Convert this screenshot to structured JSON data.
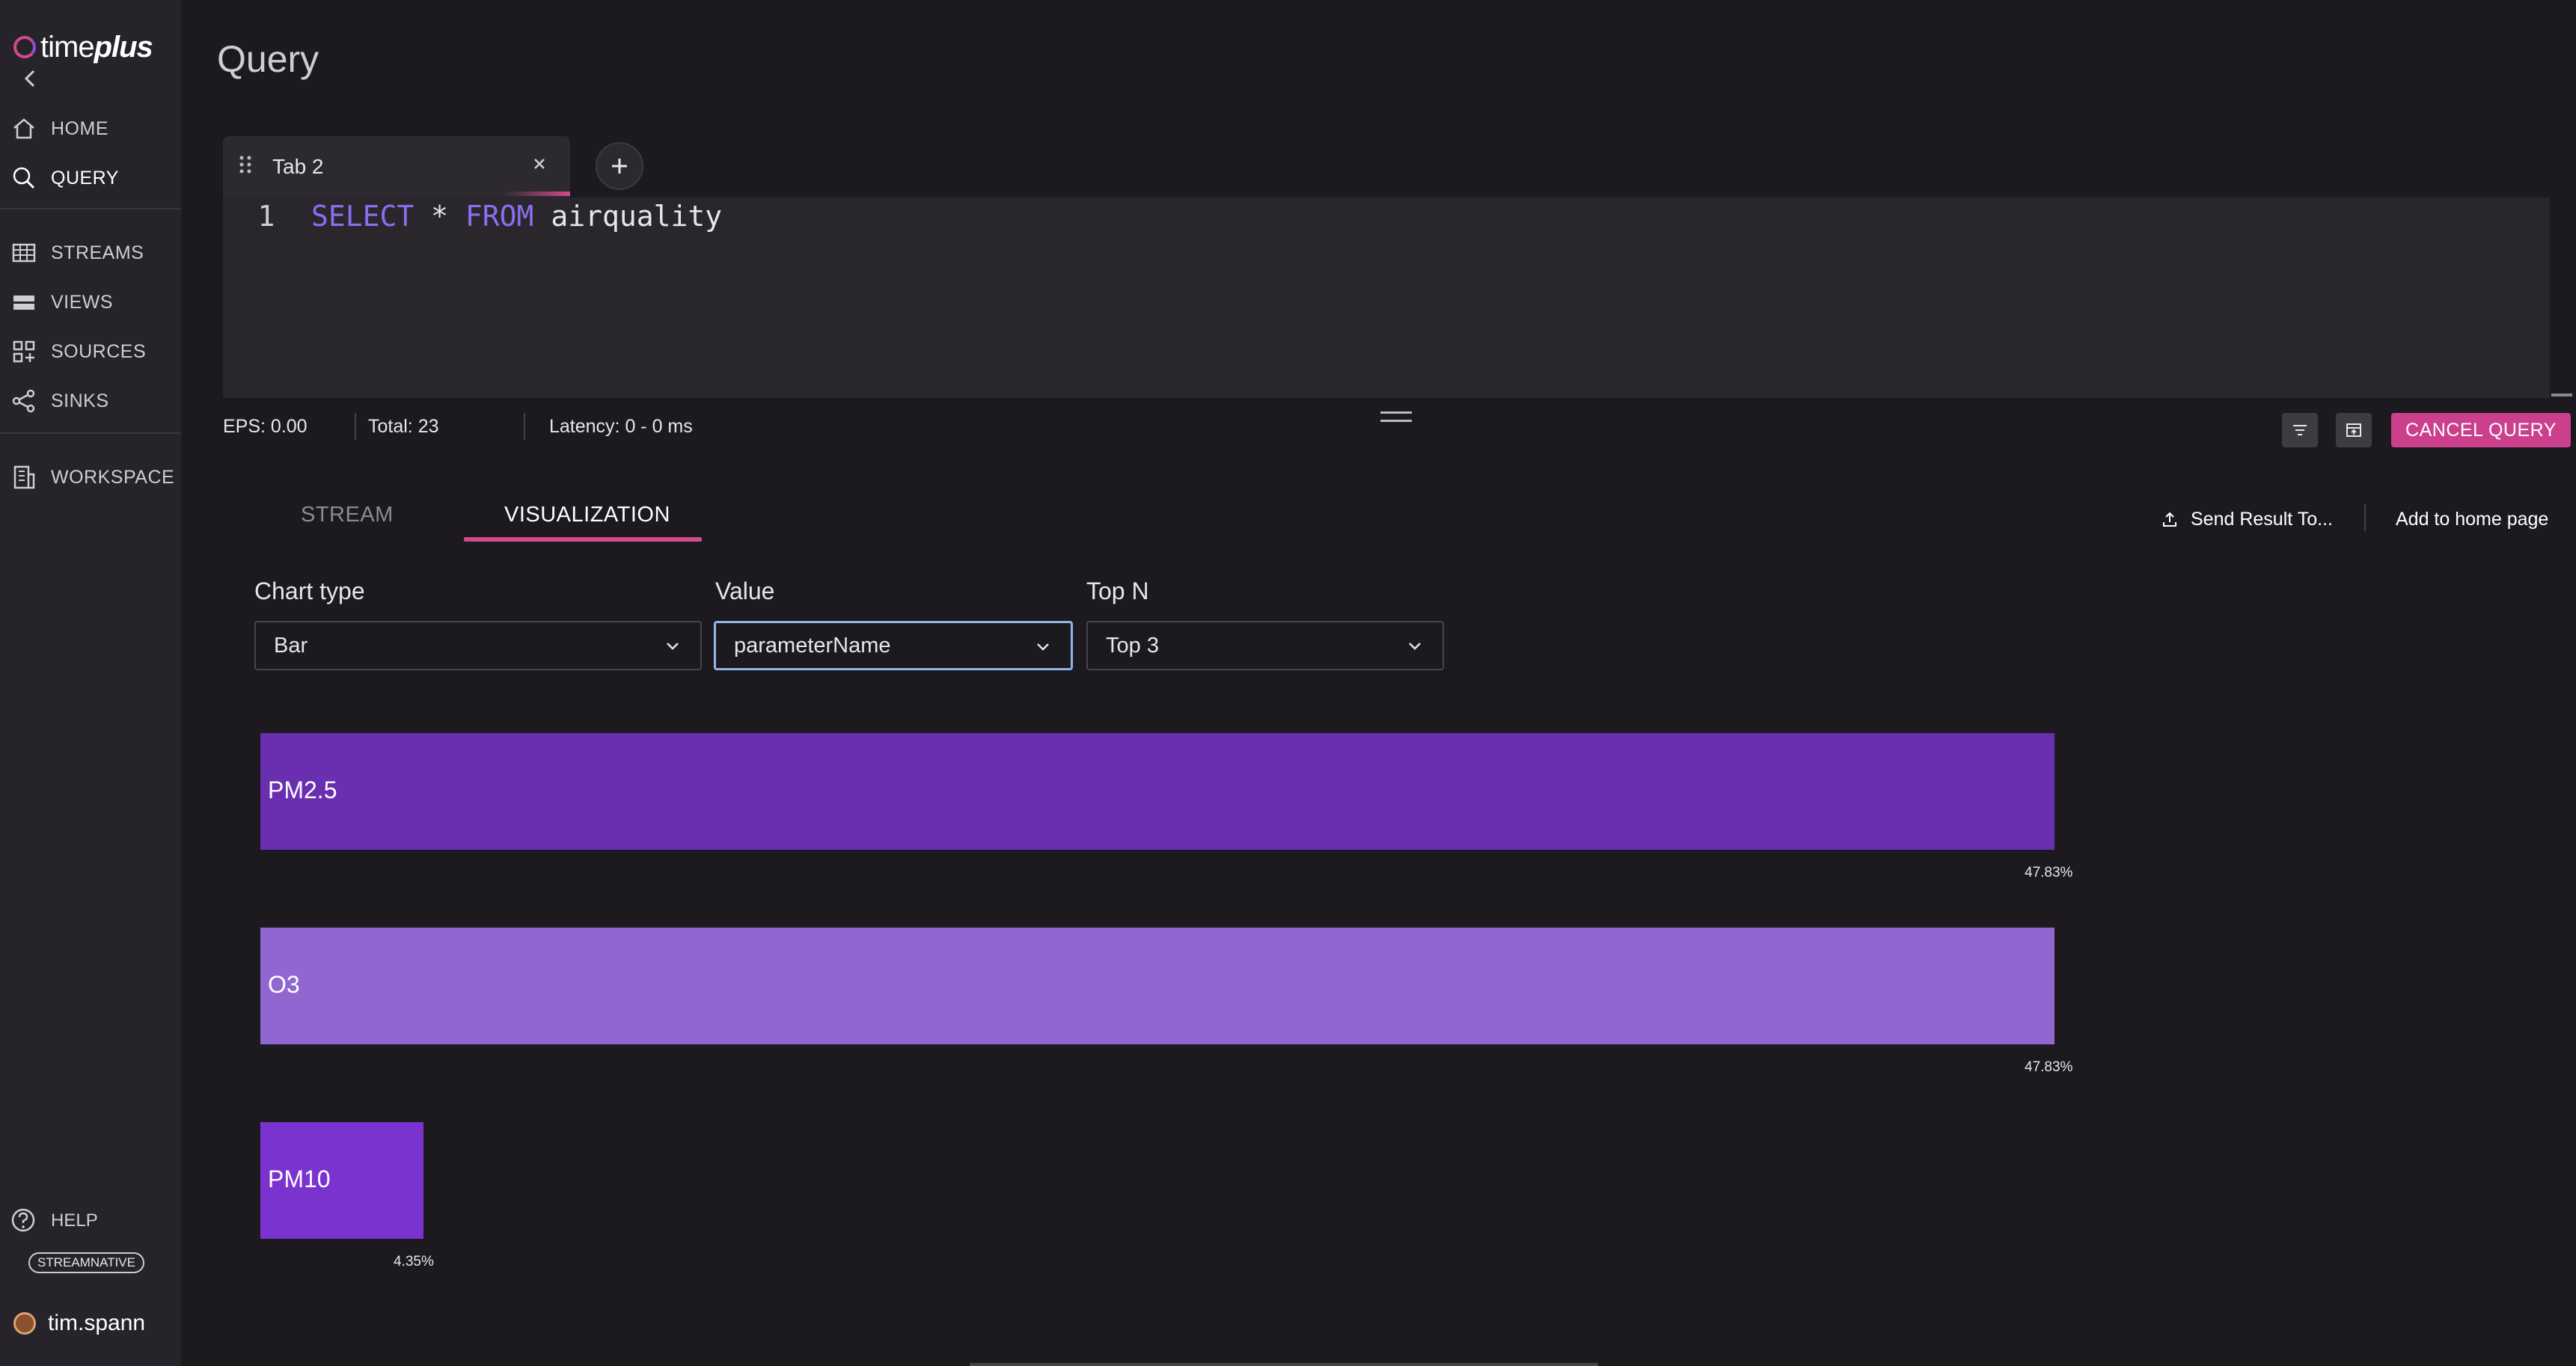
{
  "app": {
    "logo_prefix": "time",
    "logo_suffix": "plus"
  },
  "sidebar": {
    "items": [
      {
        "label": "HOME",
        "icon": "home-icon"
      },
      {
        "label": "QUERY",
        "icon": "search-icon"
      },
      {
        "label": "STREAMS",
        "icon": "table-icon"
      },
      {
        "label": "VIEWS",
        "icon": "views-icon"
      },
      {
        "label": "SOURCES",
        "icon": "sources-icon"
      },
      {
        "label": "SINKS",
        "icon": "share-icon"
      },
      {
        "label": "WORKSPACE",
        "icon": "workspace-icon"
      }
    ],
    "help_label": "HELP",
    "org_badge": "STREAMNATIVE",
    "username": "tim.spann"
  },
  "page": {
    "title": "Query"
  },
  "query_tab": {
    "label": "Tab 2"
  },
  "editor": {
    "line_number": "1",
    "tokens": {
      "select": "SELECT",
      "star": " * ",
      "from": "FROM",
      "table": " airquality"
    }
  },
  "stats": {
    "eps": "EPS: 0.00",
    "total": "Total: 23",
    "latency": "Latency: 0 - 0 ms"
  },
  "toolbar": {
    "cancel_label": "CANCEL QUERY"
  },
  "result_tabs": {
    "stream": "STREAM",
    "visualization": "VISUALIZATION"
  },
  "actions": {
    "send_result": "Send Result To...",
    "add_home": "Add to home page"
  },
  "controls": {
    "chart_type": {
      "label": "Chart type",
      "value": "Bar"
    },
    "value": {
      "label": "Value",
      "value": "parameterName"
    },
    "top_n": {
      "label": "Top N",
      "value": "Top 3"
    }
  },
  "colors": {
    "accent": "#cc3f8d",
    "bar1": "#6a2fb0",
    "bar2": "#9066d0",
    "bar3": "#7b33cf"
  },
  "chart_data": {
    "type": "bar",
    "categories": [
      "PM2.5",
      "O3",
      "PM10"
    ],
    "values": [
      47.83,
      47.83,
      4.35
    ],
    "percent_labels": [
      "47.83%",
      "47.83%",
      "4.35%"
    ]
  }
}
